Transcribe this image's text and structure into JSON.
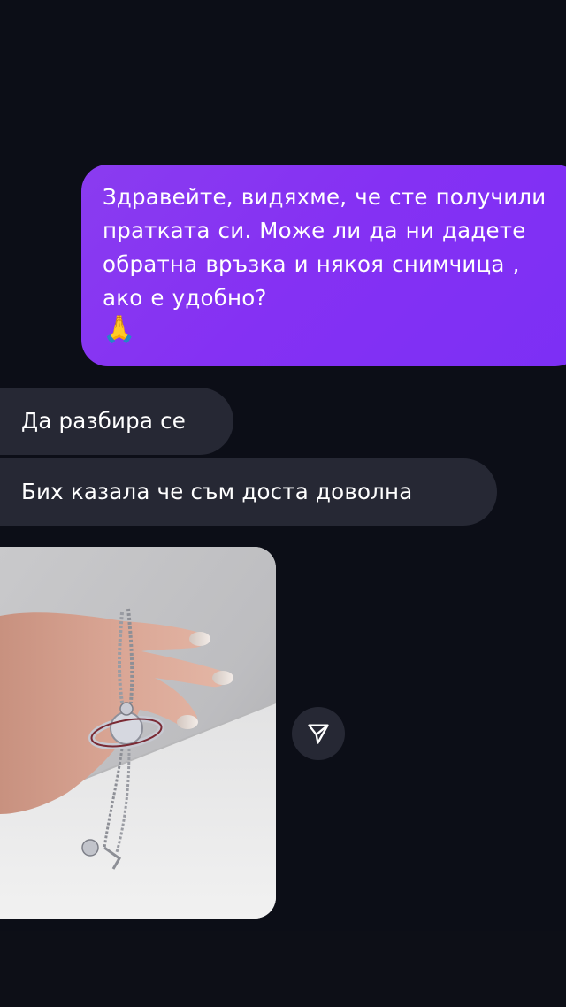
{
  "conversation": {
    "outgoing_message": {
      "text": "Здравейте, видяхме, че сте получили пратката си. Може ли да ни дадете обратна връзка и някоя снимчица , ако е удобно?",
      "emoji": "🙏"
    },
    "incoming_messages": [
      {
        "text": "Да разбира се"
      },
      {
        "text": "Бих казала че съм доста доволна"
      }
    ],
    "photo": {
      "icon": "photo-necklace-in-hand"
    },
    "share_icon": "send-icon"
  },
  "colors": {
    "background": "#0c0e17",
    "outgoing_bubble": "#8531f3",
    "incoming_bubble": "#262834",
    "text": "#ffffff"
  }
}
